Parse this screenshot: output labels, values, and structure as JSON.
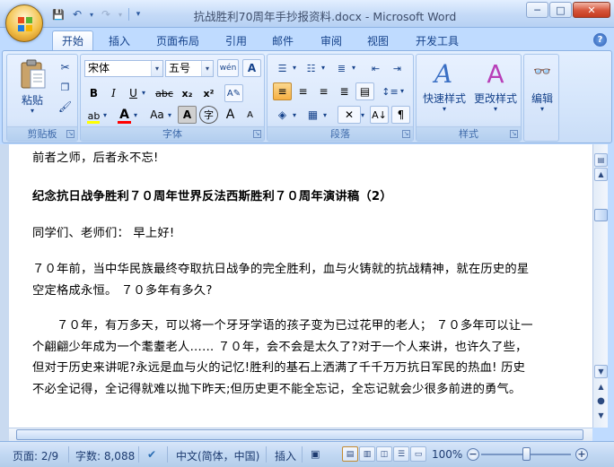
{
  "window": {
    "title": "抗战胜利70周年手抄报资料.docx - Microsoft Word",
    "controls": [
      "─",
      "□",
      "✕"
    ]
  },
  "qat": {
    "save": "💾",
    "undo": "↶",
    "redo": "↷",
    "customize": "▾"
  },
  "tabs": [
    {
      "label": "开始",
      "active": true
    },
    {
      "label": "插入"
    },
    {
      "label": "页面布局"
    },
    {
      "label": "引用"
    },
    {
      "label": "邮件"
    },
    {
      "label": "审阅"
    },
    {
      "label": "视图"
    },
    {
      "label": "开发工具"
    }
  ],
  "help": "?",
  "ribbon": {
    "clipboard": {
      "label": "剪贴板",
      "paste": "粘贴"
    },
    "font": {
      "label": "字体",
      "font_name": "宋体",
      "font_size": "五号",
      "phonetic": "wén",
      "bold": "B",
      "italic": "I",
      "underline": "U",
      "strike": "abc",
      "subscript": "x₂",
      "superscript": "x²",
      "change_case": "Aa",
      "grow": "A",
      "shrink": "A",
      "char_border": "A",
      "char_shade": "字",
      "enclose": "字",
      "highlight_color": "#ffff00",
      "font_color": "#ff0000"
    },
    "paragraph": {
      "label": "段落"
    },
    "styles": {
      "label": "样式",
      "quick_styles": "快速样式",
      "change_styles": "更改样式"
    },
    "editing": {
      "label": "编辑"
    }
  },
  "document": {
    "paragraphs": [
      {
        "text": "前者之师，后者永不忘!",
        "bold": false
      },
      {
        "text": "纪念抗日战争胜利７０周年世界反法西斯胜利７０周年演讲稿（2）",
        "bold": true
      },
      {
        "text": "同学们、老师们： 早上好!",
        "bold": false
      },
      {
        "text": "７０年前，当中华民族最终夺取抗日战争的完全胜利，血与火铸就的抗战精神，就在历史的星空定格成永恒。 ７０多年有多久?",
        "bold": false
      },
      {
        "text": "　　７０年，有万多天，可以将一个牙牙学语的孩子变为已过花甲的老人； ７０多年可以让一个翩翩少年成为一个耄耋老人…… ７０年，会不会是太久了?对于一个人来讲，也许久了些，但对于历史来讲呢?永远是血与火的记忆!胜利的基石上洒满了千千万万抗日军民的热血! 历史不必全记得，全记得就难以抛下昨天;但历史更不能全忘记，全忘记就会少很多前进的勇气。",
        "bold": false
      }
    ]
  },
  "statusbar": {
    "page": "页面: 2/9",
    "words": "字数: 8,088",
    "language": "中文(简体，中国)",
    "mode": "插入",
    "zoom": "100%",
    "zoom_level": 100
  }
}
